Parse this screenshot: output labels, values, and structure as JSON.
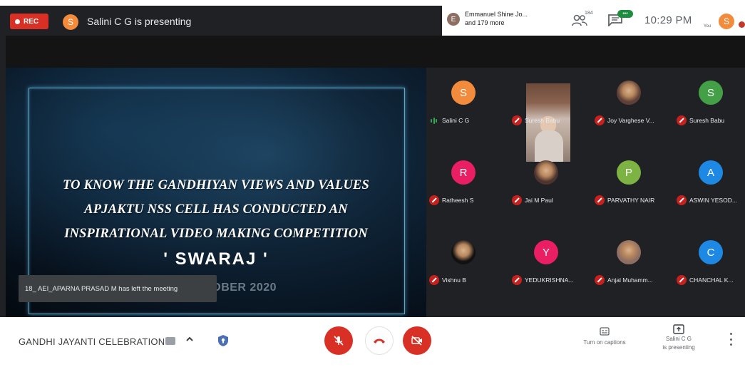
{
  "app": "Google Meet",
  "topbar": {
    "rec_label": "REC",
    "presenter_initial": "S",
    "presenter_text": "Salini C G is presenting",
    "pip_initial": "E",
    "pip_name_line1": "Emmanuel Shine Jo...",
    "pip_name_line2": "and 179 more",
    "people_count": "184",
    "chat_badge": "•••",
    "clock": "10:29 PM",
    "you_label": "You",
    "you_initial": "S"
  },
  "slide": {
    "line1": "TO KNOW THE GANDHIYAN VIEWS AND VALUES",
    "line2": "APJAKTU NSS CELL HAS CONDUCTED AN",
    "line3": "INSPIRATIONAL VIDEO MAKING COMPETITION",
    "title": "' SWARAJ '",
    "date": "ON  2 OCTOBER 2020",
    "frame_color": "#5fa8c9"
  },
  "toast": {
    "text": "18_ AEI_APARNA PRASAD M has left the meeting"
  },
  "participants": [
    {
      "name": "Salini C G",
      "initial": "S",
      "color": "#f28b3c",
      "speaking": true
    },
    {
      "name": "Suresh Babu",
      "initial": "",
      "color": "",
      "video": true
    },
    {
      "name": "Joy Varghese V...",
      "initial": "",
      "color": "#5d4037",
      "photo": true
    },
    {
      "name": "Suresh Babu",
      "initial": "S",
      "color": "#43a047"
    },
    {
      "name": "Ratheesh S",
      "initial": "R",
      "color": "#e91e63"
    },
    {
      "name": "Jai M Paul",
      "initial": "",
      "color": "#4e342e",
      "photo": true
    },
    {
      "name": "PARVATHY NAIR",
      "initial": "P",
      "color": "#7cb342"
    },
    {
      "name": "ASWIN YESOD...",
      "initial": "A",
      "color": "#1e88e5"
    },
    {
      "name": "Vishnu B",
      "initial": "",
      "color": "#111111",
      "photo": true
    },
    {
      "name": "YEDUKRISHNA...",
      "initial": "Y",
      "color": "#e91e63"
    },
    {
      "name": "Anjal Muhamm...",
      "initial": "",
      "color": "#8d6e63",
      "photo": true
    },
    {
      "name": "CHANCHAL K...",
      "initial": "C",
      "color": "#1e88e5"
    }
  ],
  "bottombar": {
    "meeting_title": "GANDHI JAYANTI CELEBRATION",
    "captions_label": "Turn on captions",
    "present_line1": "Salini C G",
    "present_line2": "is presenting"
  },
  "colors": {
    "accent_red": "#d93025",
    "meet_dark": "#202124"
  }
}
